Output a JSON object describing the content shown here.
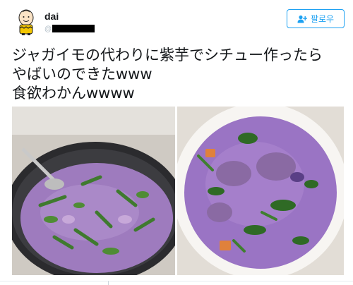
{
  "tweet": {
    "display_name": "dai",
    "handle_visible": "@",
    "follow_label": "팔로우",
    "text_lines": [
      "ジャガイモの代わりに紫芋でシチュー作ったら",
      "やばいのできたwww",
      "食欲わかんwwww"
    ]
  },
  "icons": {
    "avatar": "character-avatar",
    "follow": "add-user-icon"
  },
  "colors": {
    "accent": "#1da1f2",
    "text": "#14171a",
    "muted": "#aab8c2",
    "stew_purple": "#9c7bc0"
  }
}
